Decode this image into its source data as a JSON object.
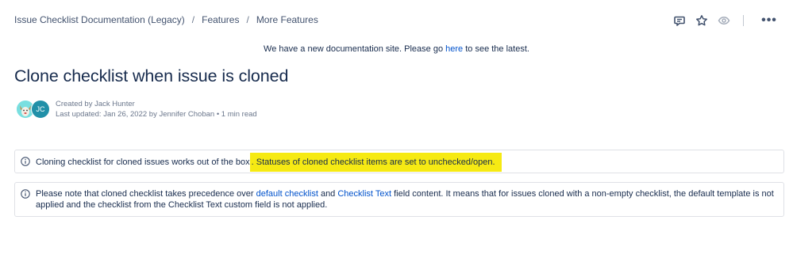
{
  "breadcrumb": {
    "items": [
      "Issue Checklist Documentation (Legacy)",
      "Features",
      "More Features"
    ],
    "separator": "/"
  },
  "actions": {
    "icons": [
      "comment-icon",
      "star-icon",
      "eye-icon",
      "more-icon"
    ],
    "more_label": "•••"
  },
  "notice": {
    "before": "We have a new documentation site. Please go ",
    "link": "here",
    "after": " to see the latest."
  },
  "page": {
    "title": "Clone checklist when issue is cloned"
  },
  "byline": {
    "created": "Created by Jack Hunter",
    "updated": "Last updated: Jan 26, 2022 by Jennifer Choban",
    "dot": " • ",
    "read_time": "1 min read",
    "avatar2_initials": "JC"
  },
  "panels": {
    "panel1": {
      "text": "Cloning checklist for cloned issues works out of the box",
      "highlight": ". Statuses of cloned checklist items are set to unchecked/open."
    },
    "panel2": {
      "t1": "Please note that cloned checklist takes precedence over ",
      "link1": "default checklist",
      "t2": " and ",
      "link2": "Checklist Text",
      "t3": " field content. It means that for issues cloned with a non-empty checklist, the default template is not applied and the checklist from the Checklist Text custom field is not applied."
    }
  },
  "colors": {
    "link": "#0052cc",
    "highlight": "#f6ea13",
    "text": "#172b4d",
    "muted": "#6b778c"
  }
}
